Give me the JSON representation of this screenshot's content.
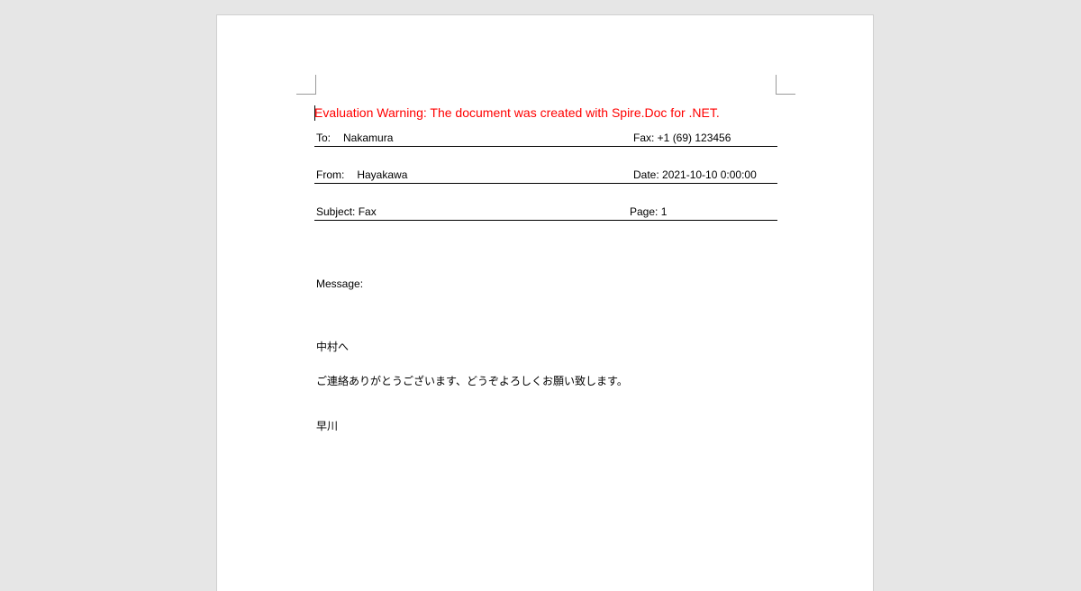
{
  "document": {
    "warning": "Evaluation Warning: The document was created with Spire.Doc for .NET.",
    "header": {
      "to_label": "To:",
      "to_value": "Nakamura",
      "fax": "Fax: +1 (69) 123456",
      "from_label": "From:",
      "from_value": "Hayakawa",
      "date": "Date: 2021-10-10 0:00:00",
      "subject": "Subject: Fax",
      "page": "Page: 1"
    },
    "message_label": "Message:",
    "body": {
      "greeting": "中村へ",
      "text": "ご連絡ありがとうございます、どうぞよろしくお願い致します。",
      "signature": "早川"
    }
  },
  "colors": {
    "warning": "#ff0000",
    "workspace": "#e6e6e6",
    "page": "#ffffff"
  }
}
